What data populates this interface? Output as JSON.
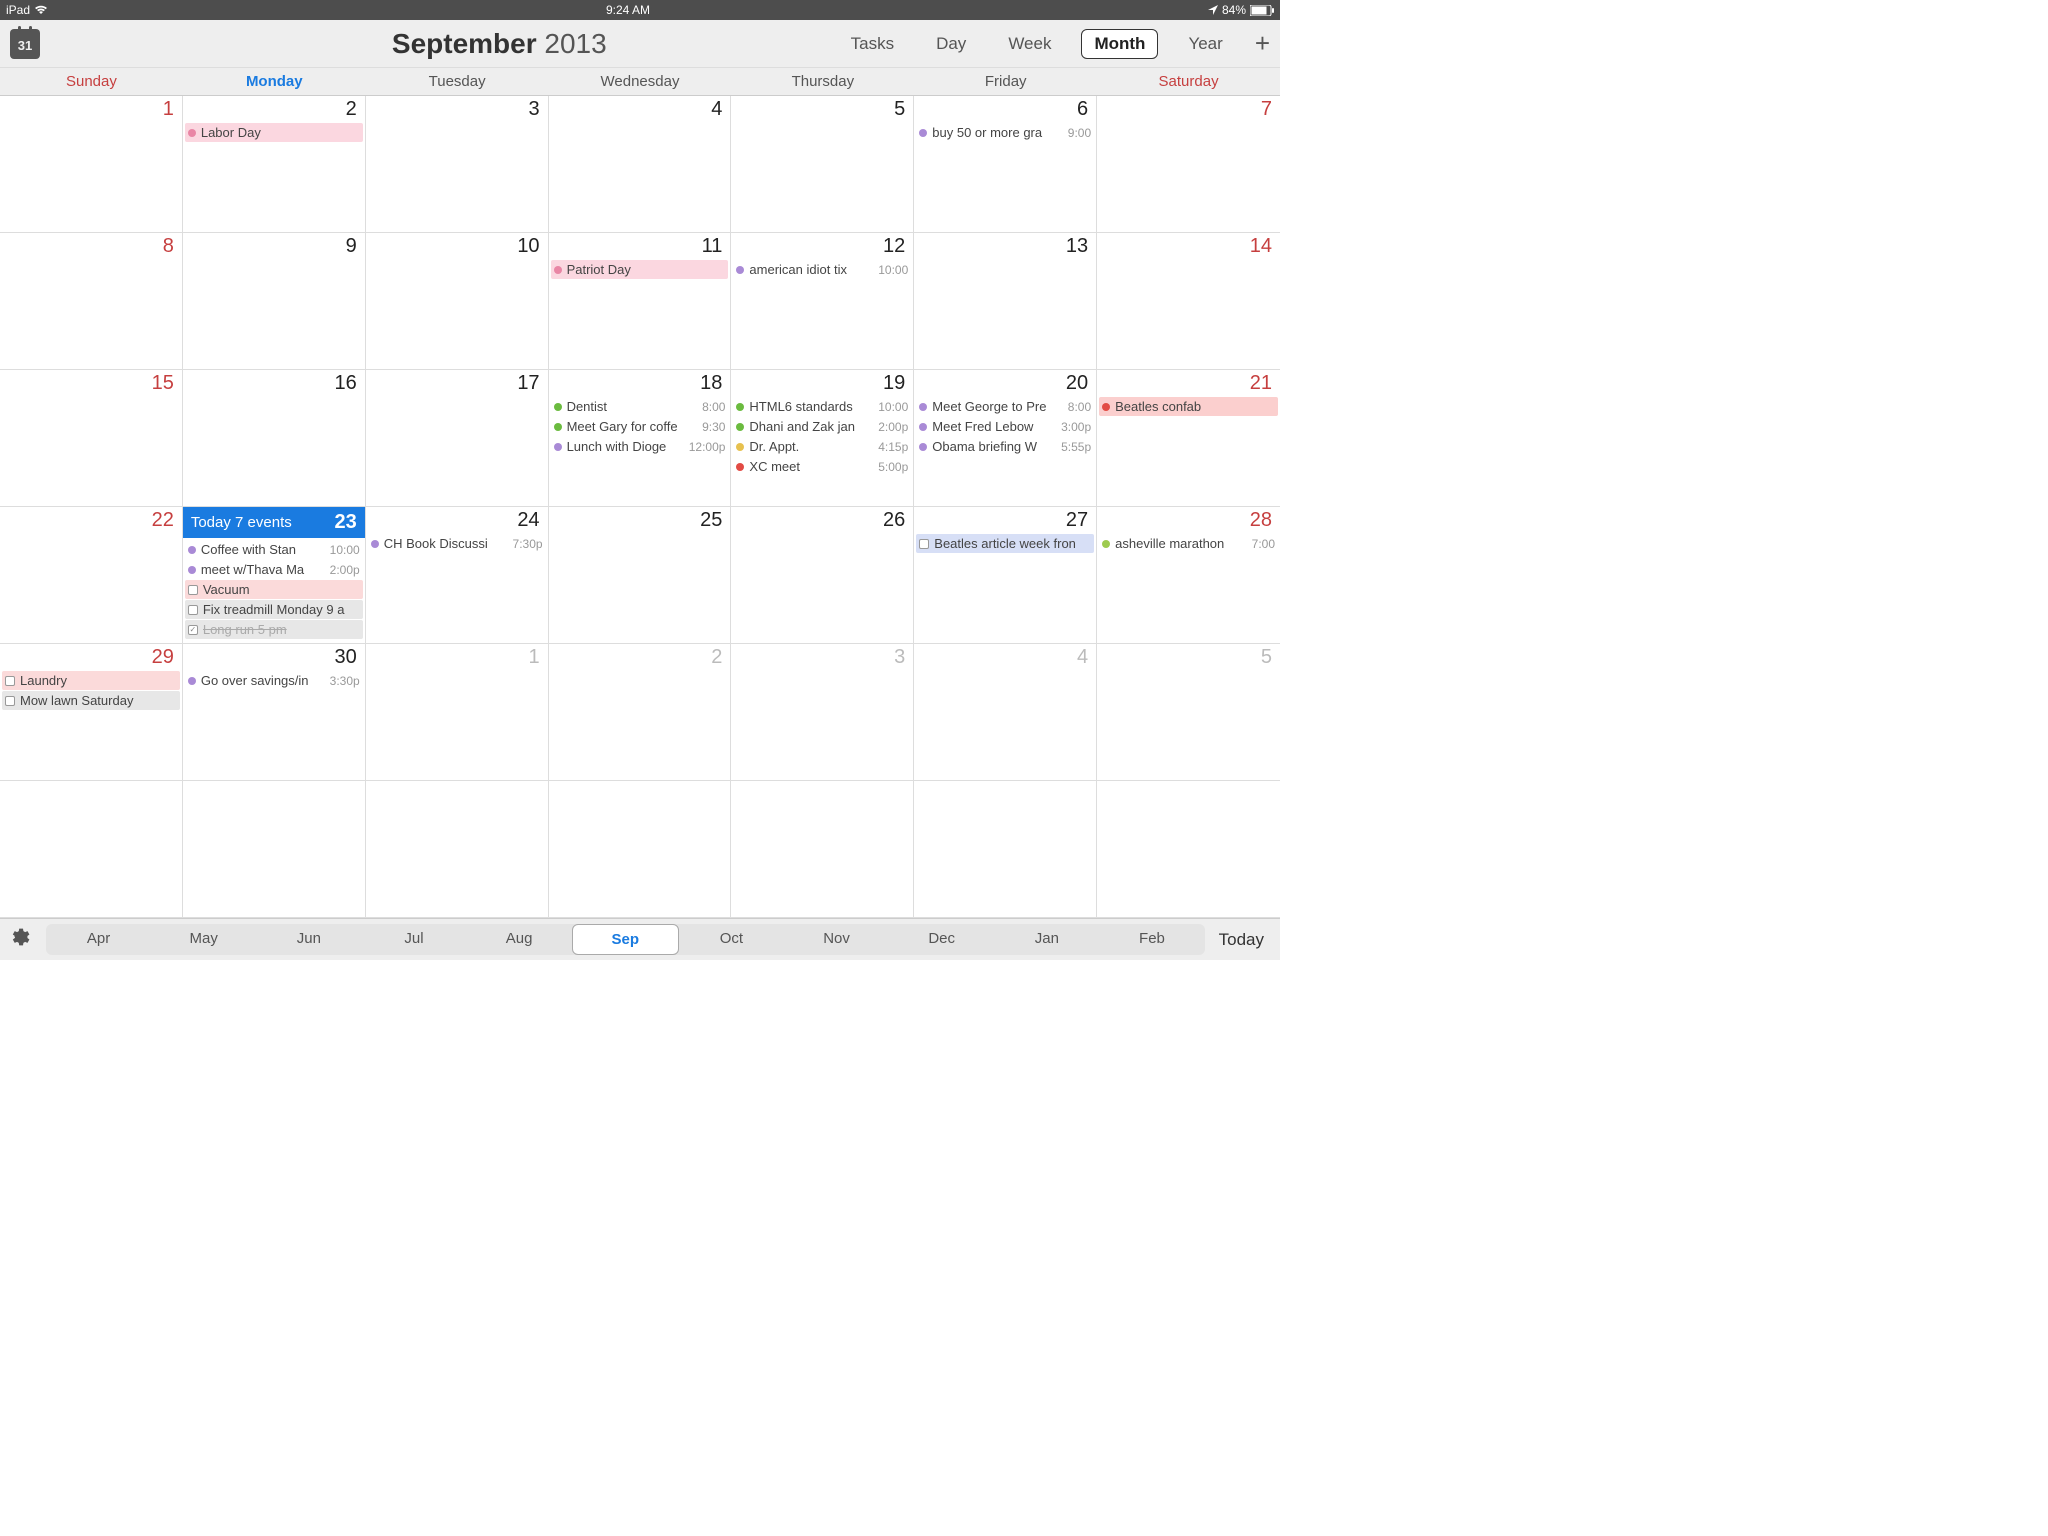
{
  "status": {
    "device": "iPad",
    "time": "9:24 AM",
    "battery": "84%"
  },
  "header": {
    "iconNum": "31",
    "month": "September",
    "year": "2013",
    "views": [
      "Tasks",
      "Day",
      "Week",
      "Month",
      "Year"
    ],
    "selectedView": "Month"
  },
  "weekdays": [
    "Sunday",
    "Monday",
    "Tuesday",
    "Wednesday",
    "Thursday",
    "Friday",
    "Saturday"
  ],
  "todayWeekdayIndex": 1,
  "todayLabel": "Today 7 events",
  "cells": [
    {
      "n": "1",
      "weekend": true,
      "events": []
    },
    {
      "n": "2",
      "events": [
        {
          "type": "bg",
          "bg": "bg-pink",
          "dotc": "c-pink",
          "label": "Labor Day"
        }
      ]
    },
    {
      "n": "3",
      "events": []
    },
    {
      "n": "4",
      "events": []
    },
    {
      "n": "5",
      "events": []
    },
    {
      "n": "6",
      "events": [
        {
          "type": "dot",
          "dotc": "c-purple",
          "label": "buy 50 or more gra",
          "time": "9:00"
        }
      ]
    },
    {
      "n": "7",
      "weekend": true,
      "events": []
    },
    {
      "n": "8",
      "weekend": true,
      "events": []
    },
    {
      "n": "9",
      "events": []
    },
    {
      "n": "10",
      "events": []
    },
    {
      "n": "11",
      "events": [
        {
          "type": "bg",
          "bg": "bg-pink",
          "dotc": "c-pink",
          "label": "Patriot Day"
        }
      ]
    },
    {
      "n": "12",
      "events": [
        {
          "type": "dot",
          "dotc": "c-purple",
          "label": "american idiot tix",
          "time": "10:00"
        }
      ]
    },
    {
      "n": "13",
      "events": []
    },
    {
      "n": "14",
      "weekend": true,
      "events": []
    },
    {
      "n": "15",
      "weekend": true,
      "events": []
    },
    {
      "n": "16",
      "events": []
    },
    {
      "n": "17",
      "events": []
    },
    {
      "n": "18",
      "events": [
        {
          "type": "dot",
          "dotc": "c-green",
          "label": "Dentist",
          "time": "8:00"
        },
        {
          "type": "dot",
          "dotc": "c-green",
          "label": "Meet Gary for coffe",
          "time": "9:30"
        },
        {
          "type": "dot",
          "dotc": "c-purple",
          "label": "Lunch with Dioge",
          "time": "12:00p"
        }
      ]
    },
    {
      "n": "19",
      "events": [
        {
          "type": "dot",
          "dotc": "c-green",
          "label": "HTML6 standards",
          "time": "10:00"
        },
        {
          "type": "dot",
          "dotc": "c-green",
          "label": "Dhani and Zak jan",
          "time": "2:00p"
        },
        {
          "type": "dot",
          "dotc": "c-yellow",
          "label": "Dr. Appt.",
          "time": "4:15p"
        },
        {
          "type": "dot",
          "dotc": "c-red",
          "label": "XC meet",
          "time": "5:00p"
        }
      ]
    },
    {
      "n": "20",
      "events": [
        {
          "type": "dot",
          "dotc": "c-purple",
          "label": "Meet George to Pre",
          "time": "8:00"
        },
        {
          "type": "dot",
          "dotc": "c-purple",
          "label": "Meet Fred Lebow",
          "time": "3:00p"
        },
        {
          "type": "dot",
          "dotc": "c-purple",
          "label": "Obama briefing W",
          "time": "5:55p"
        }
      ]
    },
    {
      "n": "21",
      "weekend": true,
      "events": [
        {
          "type": "bg",
          "bg": "bg-red",
          "dotc": "c-red",
          "label": "Beatles confab"
        }
      ]
    },
    {
      "n": "22",
      "weekend": true,
      "events": []
    },
    {
      "n": "23",
      "today": true,
      "events": [
        {
          "type": "dot",
          "dotc": "c-purple",
          "label": "Coffee with Stan",
          "time": "10:00"
        },
        {
          "type": "dot",
          "dotc": "c-purple",
          "label": "meet w/Thava Ma",
          "time": "2:00p"
        },
        {
          "type": "chk",
          "bg": "bg-redlight",
          "label": "Vacuum"
        },
        {
          "type": "chk",
          "bg": "bg-gray",
          "label": "Fix treadmill Monday 9 a"
        },
        {
          "type": "chk",
          "bg": "bg-gray",
          "label": "Long run 5 pm",
          "done": true,
          "checked": true
        }
      ]
    },
    {
      "n": "24",
      "events": [
        {
          "type": "dot",
          "dotc": "c-purple",
          "label": "CH Book Discussi",
          "time": "7:30p"
        }
      ]
    },
    {
      "n": "25",
      "events": []
    },
    {
      "n": "26",
      "events": []
    },
    {
      "n": "27",
      "events": [
        {
          "type": "chk",
          "bg": "bg-bluebox",
          "label": "Beatles article week fron"
        }
      ]
    },
    {
      "n": "28",
      "weekend": true,
      "events": [
        {
          "type": "dot",
          "dotc": "c-lime",
          "label": "asheville marathon",
          "time": "7:00"
        }
      ]
    },
    {
      "n": "29",
      "weekend": true,
      "events": [
        {
          "type": "chk",
          "bg": "bg-redlight",
          "label": "Laundry"
        },
        {
          "type": "chk",
          "bg": "bg-gray",
          "label": "Mow lawn Saturday"
        }
      ]
    },
    {
      "n": "30",
      "events": [
        {
          "type": "dot",
          "dotc": "c-purple",
          "label": "Go over savings/in",
          "time": "3:30p"
        }
      ]
    },
    {
      "n": "1",
      "other": true,
      "events": []
    },
    {
      "n": "2",
      "other": true,
      "events": []
    },
    {
      "n": "3",
      "other": true,
      "events": []
    },
    {
      "n": "4",
      "other": true,
      "events": []
    },
    {
      "n": "5",
      "other": true,
      "events": []
    },
    {
      "n": "",
      "other": true,
      "events": []
    },
    {
      "n": "",
      "other": true,
      "events": []
    },
    {
      "n": "",
      "other": true,
      "events": []
    },
    {
      "n": "",
      "other": true,
      "events": []
    },
    {
      "n": "",
      "other": true,
      "events": []
    },
    {
      "n": "",
      "other": true,
      "events": []
    },
    {
      "n": "",
      "other": true,
      "events": []
    }
  ],
  "footer": {
    "months": [
      "Apr",
      "May",
      "Jun",
      "Jul",
      "Aug",
      "Sep",
      "Oct",
      "Nov",
      "Dec",
      "Jan",
      "Feb"
    ],
    "selectedMonth": "Sep",
    "todayLabel": "Today"
  }
}
